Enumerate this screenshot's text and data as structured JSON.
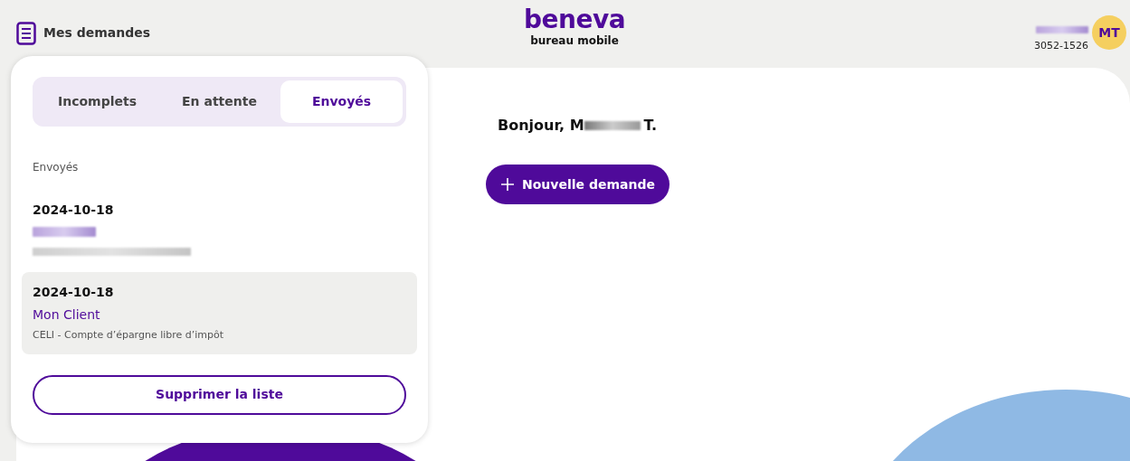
{
  "header": {
    "menu_label": "Mes demandes",
    "logo": "beneva",
    "logo_sub": "bureau mobile",
    "user_code": "3052-1526",
    "avatar_initials": "MT"
  },
  "panel": {
    "tabs": [
      {
        "label": "Incomplets",
        "selected": false
      },
      {
        "label": "En attente",
        "selected": false
      },
      {
        "label": "Envoyés",
        "selected": true
      }
    ],
    "section_title": "Envoyés",
    "requests": [
      {
        "date": "2024-10-18",
        "client_redacted": true,
        "selected": false
      },
      {
        "date": "2024-10-18",
        "client": "Mon Client",
        "product": "CELI - Compte d’épargne libre d’impôt",
        "selected": true
      }
    ],
    "clear_button": "Supprimer la liste"
  },
  "main": {
    "greeting_start": "Bonjour, M",
    "greeting_end": "T.",
    "new_button": "Nouvelle demande"
  }
}
